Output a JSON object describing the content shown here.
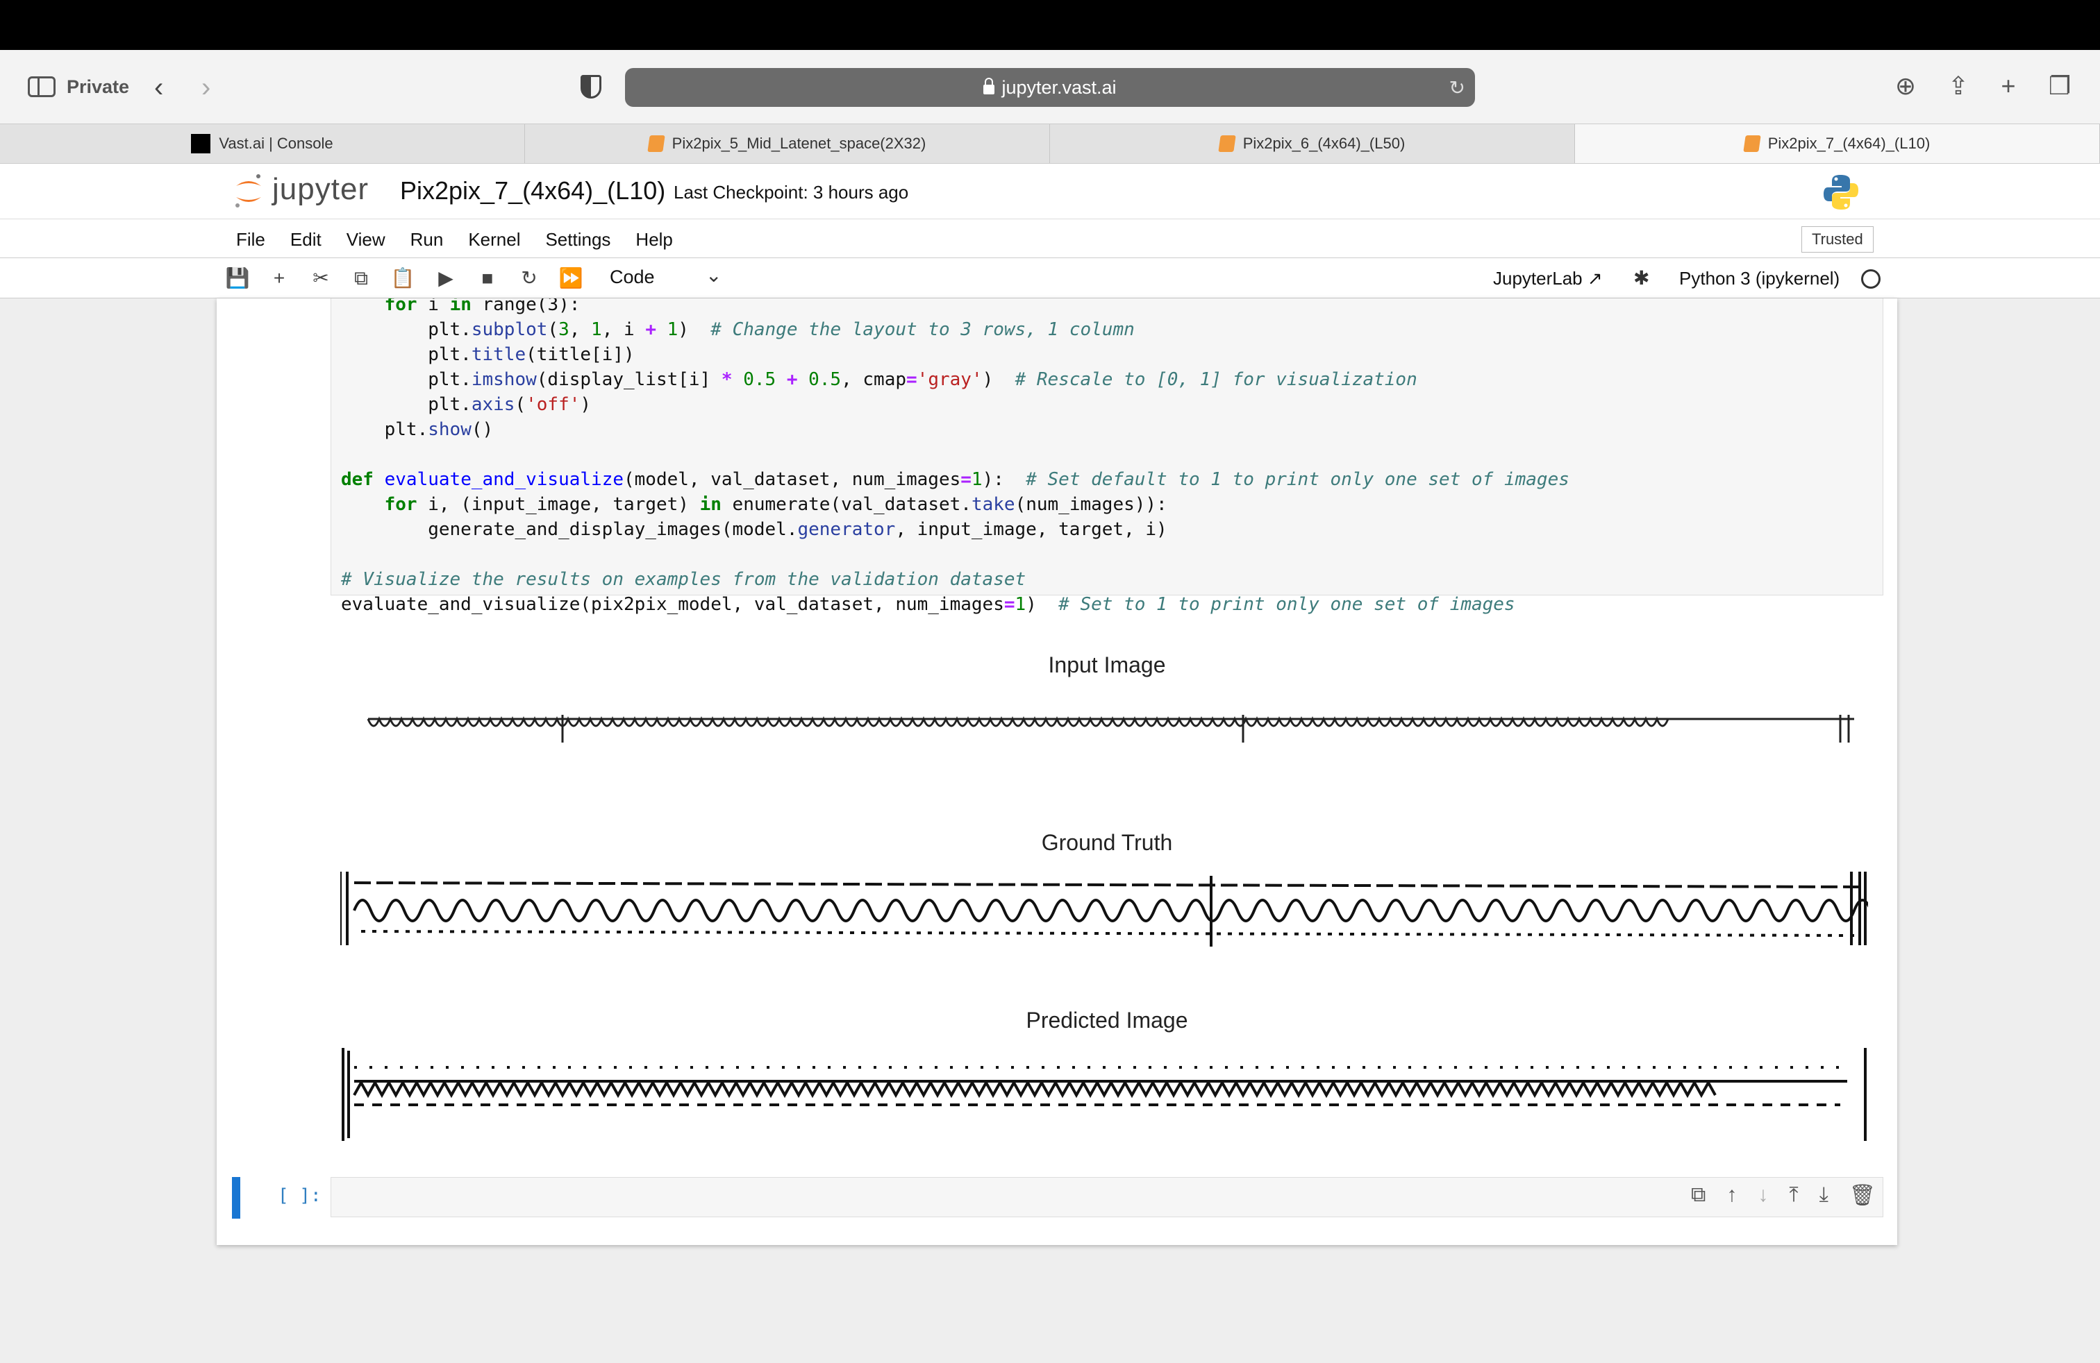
{
  "browser": {
    "private_label": "Private",
    "url": "jupyter.vast.ai",
    "tabs": [
      {
        "label": "Vast.ai | Console"
      },
      {
        "label": "Pix2pix_5_Mid_Latenet_space(2X32)"
      },
      {
        "label": "Pix2pix_6_(4x64)_(L50)"
      },
      {
        "label": "Pix2pix_7_(4x64)_(L10)"
      }
    ]
  },
  "jupyter": {
    "logo_text": "jupyter",
    "notebook_title": "Pix2pix_7_(4x64)_(L10)",
    "checkpoint": "Last Checkpoint: 3 hours ago",
    "menu": [
      "File",
      "Edit",
      "View",
      "Run",
      "Kernel",
      "Settings",
      "Help"
    ],
    "trusted": "Trusted",
    "cell_type": "Code",
    "jupyterlab_link": "JupyterLab",
    "kernel": "Python 3 (ipykernel)"
  },
  "outputs": {
    "titles": [
      "Input Image",
      "Ground Truth",
      "Predicted Image"
    ]
  },
  "empty_cell": {
    "prompt": "[ ]:"
  },
  "colors": {
    "accent": "#1976d2",
    "url_bar": "#6b6b6b",
    "notebook_icon": "#f29a3b"
  }
}
